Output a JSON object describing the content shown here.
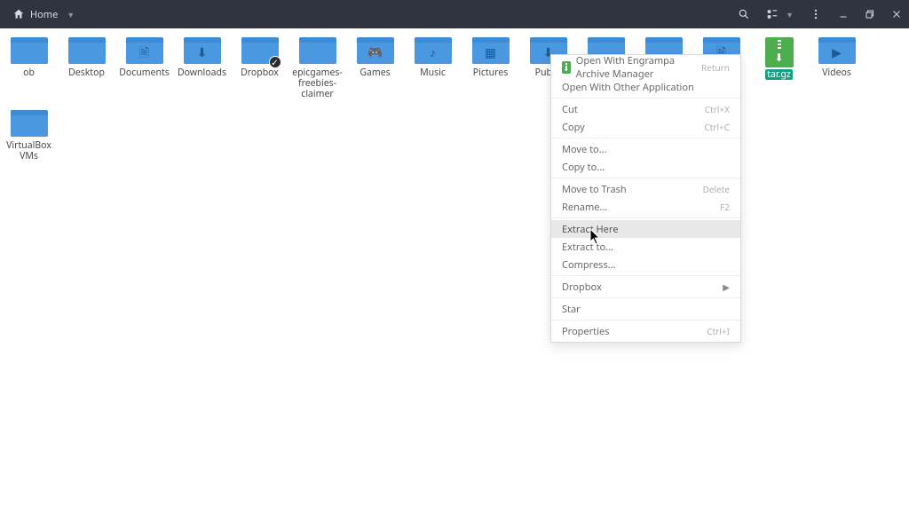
{
  "topbar": {
    "location": "Home"
  },
  "items": [
    {
      "name": "ob",
      "glyph": ""
    },
    {
      "name": "Desktop",
      "glyph": ""
    },
    {
      "name": "Documents",
      "glyph": "🗎"
    },
    {
      "name": "Downloads",
      "glyph": "⬇"
    },
    {
      "name": "Dropbox",
      "glyph": "",
      "dropbox": true
    },
    {
      "name": "epicgames-freebies-claimer",
      "glyph": ""
    },
    {
      "name": "Games",
      "glyph": "🎮"
    },
    {
      "name": "Music",
      "glyph": "♪"
    },
    {
      "name": "Pictures",
      "glyph": "▦"
    },
    {
      "name": "Public",
      "glyph": "⬇"
    },
    {
      "name": "",
      "glyph": ""
    },
    {
      "name": "",
      "glyph": ""
    },
    {
      "name": "",
      "glyph": "🗎"
    },
    {
      "name": "tar.gz",
      "archive": true,
      "selected": true
    },
    {
      "name": "Videos",
      "glyph": "▶"
    },
    {
      "name": "VirtualBox VMs",
      "glyph": ""
    }
  ],
  "menu": {
    "open_with_primary": "Open With Engrampa Archive Manager",
    "open_with_primary_shortcut": "Return",
    "open_with_other": "Open With Other Application",
    "cut": "Cut",
    "cut_shortcut": "Ctrl+X",
    "copy": "Copy",
    "copy_shortcut": "Ctrl+C",
    "move_to": "Move to...",
    "copy_to": "Copy to...",
    "move_to_trash": "Move to Trash",
    "move_to_trash_shortcut": "Delete",
    "rename": "Rename...",
    "rename_shortcut": "F2",
    "extract_here": "Extract Here",
    "extract_to": "Extract to...",
    "compress": "Compress...",
    "dropbox": "Dropbox",
    "star": "Star",
    "properties": "Properties",
    "properties_shortcut": "Ctrl+I"
  }
}
